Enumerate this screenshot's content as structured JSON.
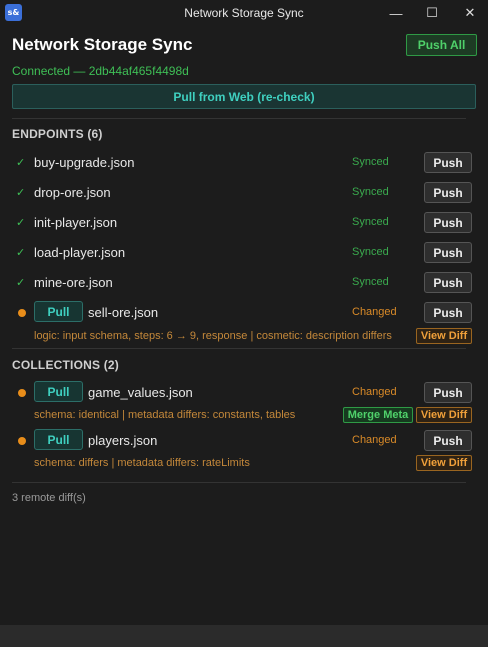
{
  "window": {
    "icon_text": "s&",
    "title": "Network Storage Sync",
    "minimize": "—",
    "maximize": "☐",
    "close": "✕"
  },
  "header": {
    "title": "Network Storage Sync",
    "push_all": "Push All",
    "connection": "Connected — 2db44af465f4498d",
    "pull_web": "Pull from Web (re-check)"
  },
  "endpoints": {
    "title": "ENDPOINTS (6)",
    "items": [
      {
        "name": "buy-upgrade.json",
        "status": "Synced",
        "push": "Push"
      },
      {
        "name": "drop-ore.json",
        "status": "Synced",
        "push": "Push"
      },
      {
        "name": "init-player.json",
        "status": "Synced",
        "push": "Push"
      },
      {
        "name": "load-player.json",
        "status": "Synced",
        "push": "Push"
      },
      {
        "name": "mine-ore.json",
        "status": "Synced",
        "push": "Push"
      },
      {
        "name": "sell-ore.json",
        "status": "Changed",
        "push": "Push",
        "pull": "Pull",
        "detail": "logic: input schema, steps: 6 → 9, response | cosmetic: description differs",
        "view_diff": "View Diff"
      }
    ]
  },
  "collections": {
    "title": "COLLECTIONS (2)",
    "items": [
      {
        "name": "game_values.json",
        "status": "Changed",
        "push": "Push",
        "pull": "Pull",
        "detail": "schema: identical | metadata differs: constants, tables",
        "merge_meta": "Merge Meta",
        "view_diff": "View Diff"
      },
      {
        "name": "players.json",
        "status": "Changed",
        "push": "Push",
        "pull": "Pull",
        "detail": "schema: differs | metadata differs: rateLimits",
        "view_diff": "View Diff"
      }
    ]
  },
  "footer": {
    "remote_diffs": "3 remote diff(s)"
  },
  "colors": {
    "synced": "#3aaa4e",
    "changed": "#d98a28",
    "accent_teal": "#3fd0c0",
    "accent_green": "#4fd16a"
  }
}
